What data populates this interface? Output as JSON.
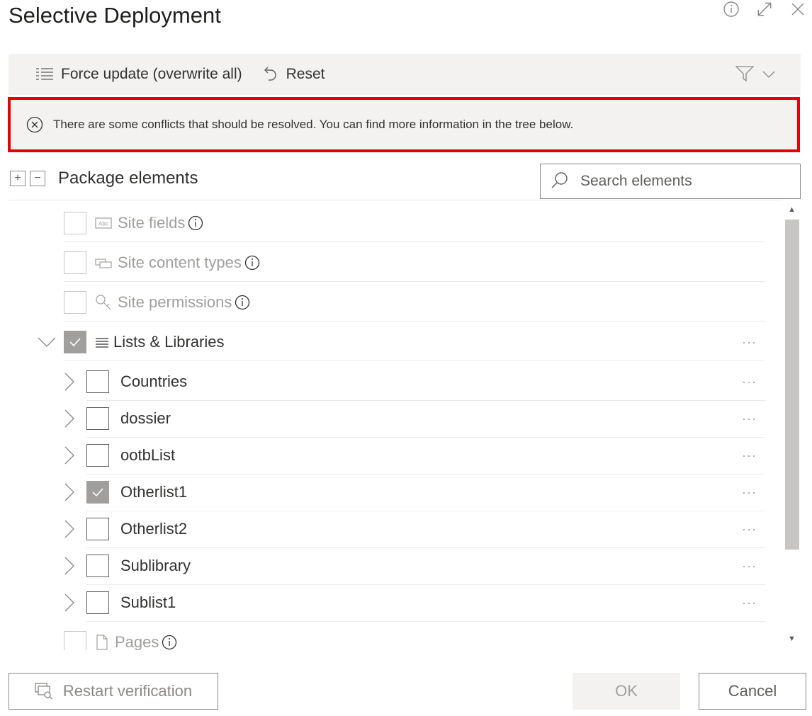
{
  "dialog": {
    "title": "Selective Deployment"
  },
  "toolbar": {
    "force_update_label": "Force update (overwrite all)",
    "reset_label": "Reset"
  },
  "conflict_message": "There are some conflicts that should be resolved. You can find more information in the tree below.",
  "package": {
    "label": "Package elements",
    "search_placeholder": "Search elements"
  },
  "tree": {
    "disabled_top": [
      {
        "label": "Site fields",
        "icon": "abc-field-icon"
      },
      {
        "label": "Site content types",
        "icon": "content-type-icon"
      },
      {
        "label": "Site permissions",
        "icon": "key-icon"
      }
    ],
    "group": {
      "label": "Lists & Libraries",
      "checked": true,
      "expanded": true,
      "icon": "list-icon"
    },
    "children": [
      {
        "label": "Countries",
        "checked": false
      },
      {
        "label": "dossier",
        "checked": false
      },
      {
        "label": "ootbList",
        "checked": false
      },
      {
        "label": "Otherlist1",
        "checked": true
      },
      {
        "label": "Otherlist2",
        "checked": false
      },
      {
        "label": "Sublibrary",
        "checked": false
      },
      {
        "label": "Sublist1",
        "checked": false
      }
    ],
    "disabled_bottom": [
      {
        "label": "Pages",
        "icon": "page-icon"
      }
    ],
    "more_label": "···"
  },
  "footer": {
    "restart_label": "Restart verification",
    "ok_label": "OK",
    "cancel_label": "Cancel"
  },
  "colors": {
    "conflict_border": "#e60000",
    "bar_bg": "#f3f2f1",
    "checked_fill": "#a19f9d"
  }
}
